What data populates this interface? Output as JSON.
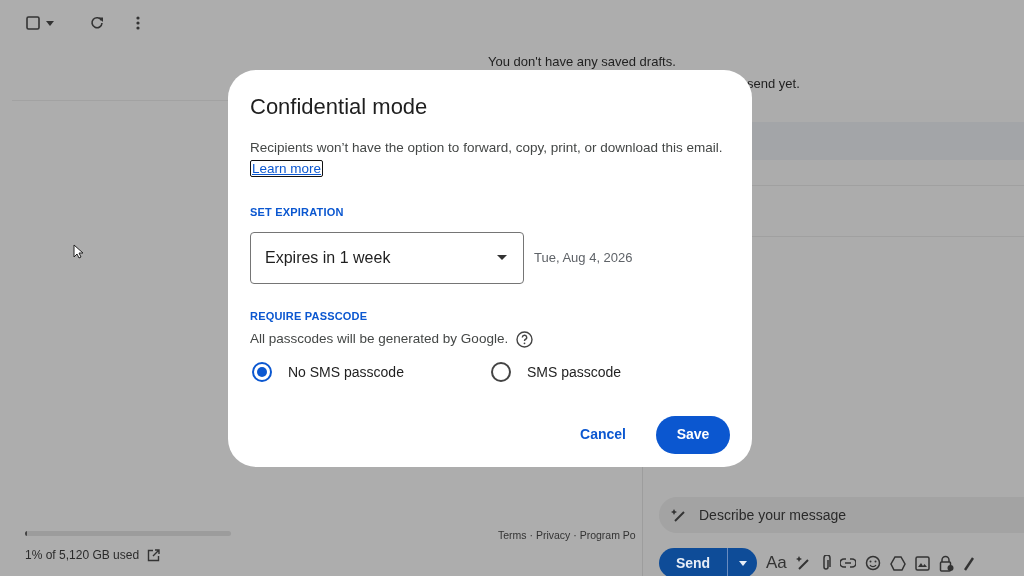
{
  "inbox": {
    "empty_message": "You don't have any saved drafts.",
    "partial_message": "send yet."
  },
  "footer": {
    "storage": {
      "level": 0.01,
      "text": "1% of 5,120 GB used"
    },
    "links": "Terms · Privacy · Program Po"
  },
  "compose": {
    "prompt": {
      "placeholder": "Describe your message"
    },
    "send": "Send",
    "format": "Aa"
  },
  "dialog": {
    "title": "Confidential mode",
    "description": "Recipients won’t have the option to forward, copy, print, or download this email.",
    "link": "Learn more",
    "expiration": {
      "label": "SET EXPIRATION",
      "value": "Expires in 1 week",
      "date": "Tue, Aug 4, 2026"
    },
    "passcode": {
      "label": "REQUIRE PASSCODE",
      "note": "All passcodes will be generated by Google.",
      "options": [
        {
          "label": "No SMS passcode",
          "selected": true
        },
        {
          "label": "SMS passcode",
          "selected": false
        }
      ]
    },
    "buttons": [
      {
        "label": "Cancel",
        "kind": "text"
      },
      {
        "label": "Save",
        "kind": "filled"
      }
    ]
  }
}
